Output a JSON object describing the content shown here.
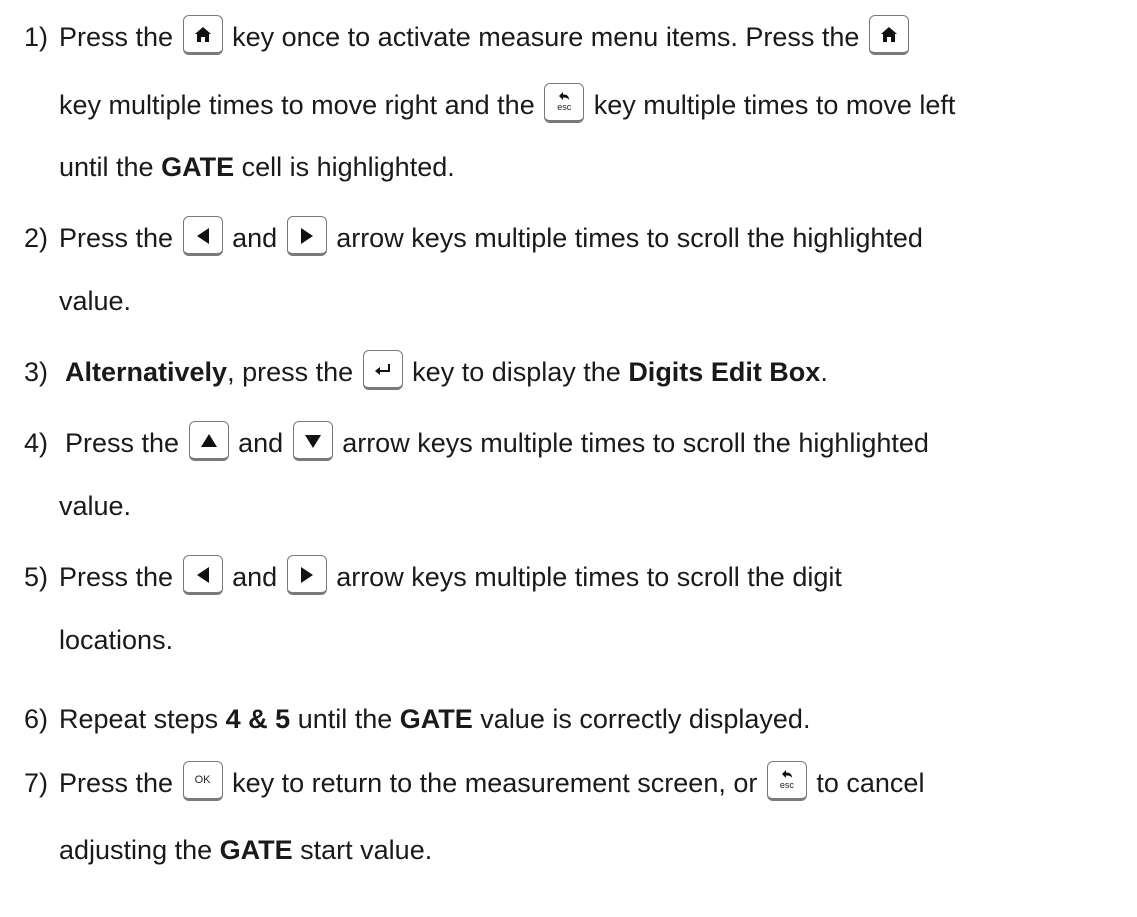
{
  "steps": [
    {
      "num": "1)",
      "line1": [
        "Press the",
        "key once to activate measure menu items.  Press the"
      ],
      "line2": [
        "key multiple times to move right and the",
        "key multiple times to move left"
      ],
      "line3": [
        "until the",
        "GATE",
        "cell is highlighted."
      ]
    },
    {
      "num": "2)",
      "line1": [
        "Press the",
        "and",
        "arrow keys multiple times to scroll the highlighted"
      ],
      "line2": [
        "value."
      ]
    },
    {
      "num": "3)",
      "line1": [
        "Alternatively",
        ", press the",
        "key to display the",
        "Digits Edit Box",
        "."
      ]
    },
    {
      "num": "4)",
      "line1": [
        "Press the",
        "and",
        "arrow keys multiple times to scroll the highlighted"
      ],
      "line2": [
        "value."
      ]
    },
    {
      "num": "5)",
      "line1": [
        "Press the",
        "and",
        "arrow keys multiple times to scroll the digit"
      ],
      "line2": [
        "locations."
      ]
    },
    {
      "num": "6)",
      "line1": [
        "Repeat steps",
        "4 & 5",
        "until the",
        "GATE",
        "value is correctly displayed."
      ]
    },
    {
      "num": "7)",
      "line1": [
        "Press the",
        "key to return to the measurement screen, or",
        "to cancel"
      ],
      "line2": [
        "adjusting the",
        "GATE",
        "start value."
      ]
    }
  ],
  "keys": {
    "home": "home-key",
    "esc_label": "esc",
    "ok_label": "OK",
    "enter": "enter-key",
    "left": "left-arrow-key",
    "right": "right-arrow-key",
    "up": "up-arrow-key",
    "down": "down-arrow-key"
  }
}
